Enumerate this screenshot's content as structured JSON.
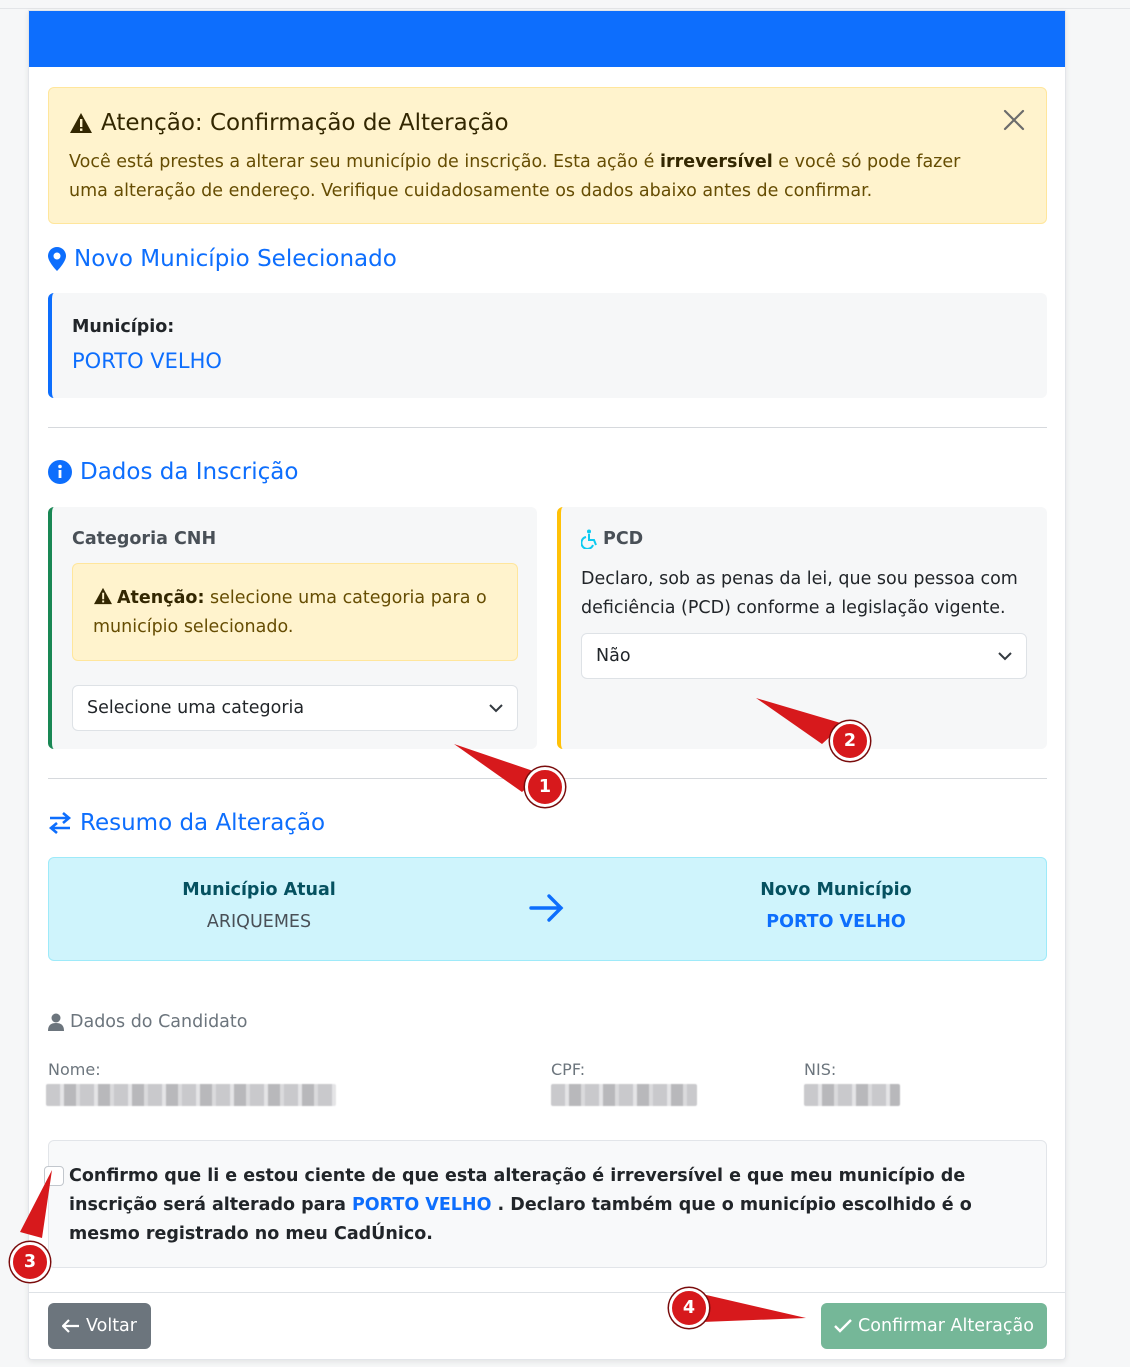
{
  "alert": {
    "title": "Atenção: Confirmação de Alteração",
    "text_before": "Você está prestes a alterar seu município de inscrição. Esta ação é ",
    "text_bold": "irreversível",
    "text_after": " e você só pode fazer uma alteração de endereço. Verifique cuidadosamente os dados abaixo antes de confirmar."
  },
  "novo_municipio": {
    "heading": "Novo Município Selecionado",
    "label": "Município:",
    "value": "PORTO VELHO"
  },
  "dados_inscricao": {
    "heading": "Dados da Inscrição",
    "categoria": {
      "title": "Categoria CNH",
      "alert_bold": "Atenção:",
      "alert_text": " selecione uma categoria para o município selecionado.",
      "select_value": "Selecione uma categoria"
    },
    "pcd": {
      "title": "PCD",
      "text": "Declaro, sob as penas da lei, que sou pessoa com deficiência (PCD) conforme a legislação vigente.",
      "select_value": "Não"
    }
  },
  "resumo": {
    "heading": "Resumo da Alteração",
    "atual_label": "Município Atual",
    "atual_value": "ARIQUEMES",
    "novo_label": "Novo Município",
    "novo_value": "PORTO VELHO"
  },
  "candidato": {
    "heading": "Dados do Candidato",
    "nome_label": "Nome:",
    "cpf_label": "CPF:",
    "nis_label": "NIS:"
  },
  "confirmacao": {
    "text_before": "Confirmo que li e estou ciente de que esta alteração é irreversível e que meu município de inscrição será alterado para ",
    "highlight": "PORTO VELHO",
    "text_after": " . Declaro também que o município escolhido é o mesmo registrado no meu CadÚnico."
  },
  "buttons": {
    "back": "Voltar",
    "confirm": "Confirmar Alteração"
  },
  "markers": [
    "1",
    "2",
    "3",
    "4"
  ],
  "colors": {
    "primary": "#0d6efd",
    "warning_bg": "#fff3cd",
    "info_bg": "#cff4fc",
    "success_border": "#198754",
    "warning_border": "#ffc107",
    "marker_red": "#d7191c"
  }
}
